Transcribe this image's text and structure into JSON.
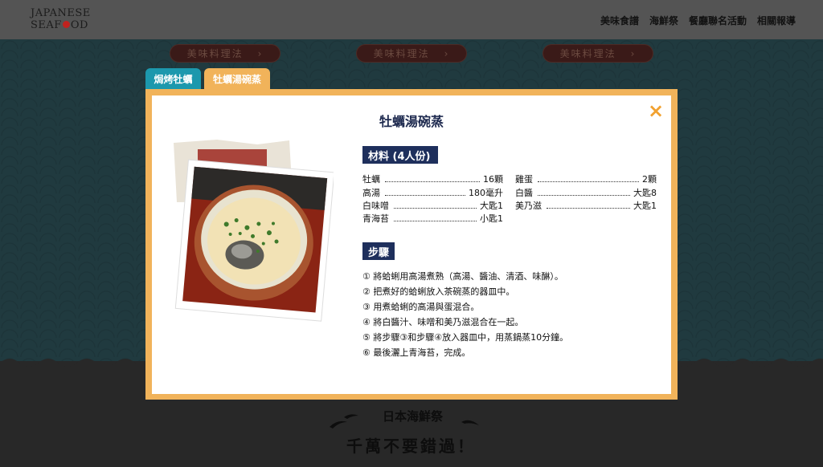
{
  "header": {
    "logo_line1": "JAPANESE",
    "logo_line2_pre": "SEAF",
    "logo_line2_post": "OD",
    "nav": [
      "美味食譜",
      "海鮮祭",
      "餐廳聯名活動",
      "相關報導"
    ]
  },
  "pills": [
    {
      "label": "美味料理法",
      "arrow": "›"
    },
    {
      "label": "美味料理法",
      "arrow": "›"
    },
    {
      "label": "美味料理法",
      "arrow": "›"
    }
  ],
  "tabs": [
    "焗烤牡蠣",
    "牡蠣湯碗蒸"
  ],
  "modal": {
    "close_icon": "×",
    "title": "牡蠣湯碗蒸",
    "ingredients_label": "材料 (4人份)",
    "ingredients_left": [
      {
        "name": "牡蠣",
        "qty": "16顆"
      },
      {
        "name": "高湯",
        "qty": "180毫升"
      },
      {
        "name": "白味噌",
        "qty": "大匙1"
      },
      {
        "name": "青海苔",
        "qty": "小匙1"
      }
    ],
    "ingredients_right": [
      {
        "name": "雞蛋",
        "qty": "2顆"
      },
      {
        "name": "白醬",
        "qty": "大匙8"
      },
      {
        "name": "美乃滋",
        "qty": "大匙1"
      }
    ],
    "steps_label": "步驟",
    "steps": [
      "① 將蛤蜊用高湯煮熟（高湯、醬油、清酒、味醂）。",
      "② 把煮好的蛤蜊放入茶碗蒸的器皿中。",
      "③ 用煮蛤蜊的高湯與蛋混合。",
      "④ 將白醬汁、味噌和美乃滋混合在一起。",
      "⑤ 將步驟③和步驟④放入器皿中，用蒸鍋蒸10分鐘。",
      "⑥ 最後灑上青海苔，完成。"
    ]
  },
  "footer": {
    "slogan1": "日本海鮮祭",
    "slogan2": "千萬不要錯過！"
  },
  "colors": {
    "accent_orange": "#f1b35a",
    "tab_blue": "#1c98ad",
    "navy": "#1e2f5c"
  }
}
